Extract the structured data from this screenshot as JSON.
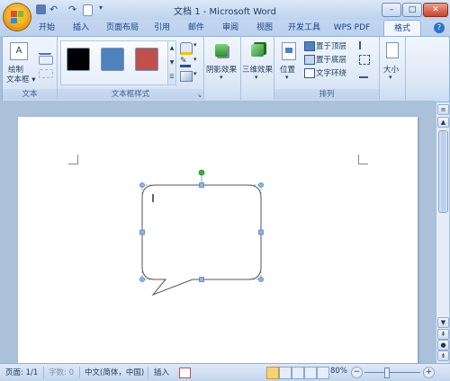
{
  "window": {
    "title": "文档 1 - Microsoft Word",
    "controls": {
      "minimize": "–",
      "maximize": "□",
      "close": "✕"
    }
  },
  "quick_access": [
    "save-icon",
    "undo-icon",
    "redo-icon",
    "print-preview-icon",
    "customize-icon"
  ],
  "tabs": [
    {
      "label": "开始"
    },
    {
      "label": "插入"
    },
    {
      "label": "页面布局"
    },
    {
      "label": "引用"
    },
    {
      "label": "邮件"
    },
    {
      "label": "审阅"
    },
    {
      "label": "视图"
    },
    {
      "label": "开发工具"
    },
    {
      "label": "WPS PDF"
    },
    {
      "label": "格式"
    }
  ],
  "active_tab": "格式",
  "ribbon": {
    "text_group": {
      "draw_textbox": "绘制",
      "draw_textbox_2": "文本框 ▾",
      "label": "文本"
    },
    "style_group": {
      "label": "文本框样式",
      "swatches": [
        "#000000",
        "#4f81bd",
        "#c0504d"
      ]
    },
    "shadow_group": {
      "label": "阴影效果"
    },
    "threed_group": {
      "label": "三维效果"
    },
    "arrange_group": {
      "position": "位置",
      "bring_front": "置于顶层",
      "send_back": "置于底层",
      "text_wrap": "文字环绕",
      "label": "排列"
    },
    "size_group": {
      "label": "大小"
    }
  },
  "statusbar": {
    "page": "页面: 1/1",
    "words": "字数: 0",
    "language": "中文(简体，中国)",
    "mode": "插入",
    "zoom": "80%"
  },
  "colors": {
    "accent": "#15428b",
    "callout_outline": "#555555",
    "handle": "#4f81bd",
    "rotate_handle": "#3cb043"
  }
}
